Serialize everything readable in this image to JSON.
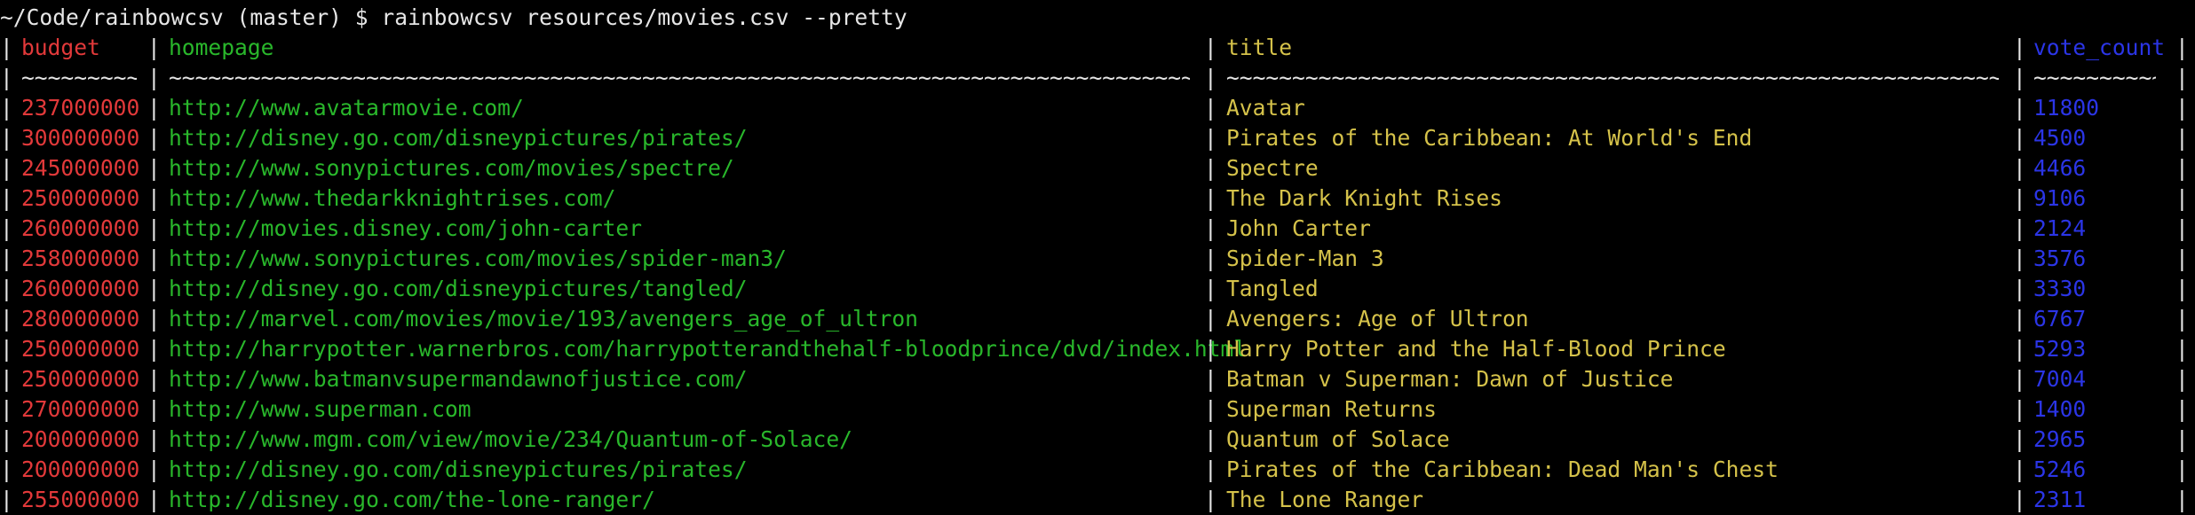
{
  "terminal": {
    "prompt": "~/Code/rainbowcsv (master) $ rainbowcsv resources/movies.csv --pretty",
    "separator": "|",
    "colors": {
      "budget": "#e2393a",
      "homepage": "#29b72b",
      "title": "#d5c24a",
      "vote_count": "#2b35e6",
      "text": "#e6e6e6",
      "background": "#000000"
    }
  },
  "table": {
    "headers": [
      "budget",
      "homepage",
      "title",
      "vote_count"
    ],
    "underlines": {
      "budget": "~~~~~~~~~",
      "homepage": "~~~~~~~~~~~~~~~~~~~~~~~~~~~~~~~~~~~~~~~~~~~~~~~~~~~~~~~~~~~~~~~~~~~~~~~~~~~~~~~~~~~~~~",
      "title": "~~~~~~~~~~~~~~~~~~~~~~~~~~~~~~~~~~~~~~~~~~~~~~~~~~~~~~~~~~~~~~~~~~~~~~~~~~~~~~~~~~~~",
      "vote_count": "~~~~~~~~~~"
    },
    "rows": [
      {
        "budget": "237000000",
        "homepage": "http://www.avatarmovie.com/",
        "title": "Avatar",
        "vote_count": "11800"
      },
      {
        "budget": "300000000",
        "homepage": "http://disney.go.com/disneypictures/pirates/",
        "title": "Pirates of the Caribbean: At World's End",
        "vote_count": "4500"
      },
      {
        "budget": "245000000",
        "homepage": "http://www.sonypictures.com/movies/spectre/",
        "title": "Spectre",
        "vote_count": "4466"
      },
      {
        "budget": "250000000",
        "homepage": "http://www.thedarkknightrises.com/",
        "title": "The Dark Knight Rises",
        "vote_count": "9106"
      },
      {
        "budget": "260000000",
        "homepage": "http://movies.disney.com/john-carter",
        "title": "John Carter",
        "vote_count": "2124"
      },
      {
        "budget": "258000000",
        "homepage": "http://www.sonypictures.com/movies/spider-man3/",
        "title": "Spider-Man 3",
        "vote_count": "3576"
      },
      {
        "budget": "260000000",
        "homepage": "http://disney.go.com/disneypictures/tangled/",
        "title": "Tangled",
        "vote_count": "3330"
      },
      {
        "budget": "280000000",
        "homepage": "http://marvel.com/movies/movie/193/avengers_age_of_ultron",
        "title": "Avengers: Age of Ultron",
        "vote_count": "6767"
      },
      {
        "budget": "250000000",
        "homepage": "http://harrypotter.warnerbros.com/harrypotterandthehalf-bloodprince/dvd/index.html",
        "title": "Harry Potter and the Half-Blood Prince",
        "vote_count": "5293"
      },
      {
        "budget": "250000000",
        "homepage": "http://www.batmanvsupermandawnofjustice.com/",
        "title": "Batman v Superman: Dawn of Justice",
        "vote_count": "7004"
      },
      {
        "budget": "270000000",
        "homepage": "http://www.superman.com",
        "title": "Superman Returns",
        "vote_count": "1400"
      },
      {
        "budget": "200000000",
        "homepage": "http://www.mgm.com/view/movie/234/Quantum-of-Solace/",
        "title": "Quantum of Solace",
        "vote_count": "2965"
      },
      {
        "budget": "200000000",
        "homepage": "http://disney.go.com/disneypictures/pirates/",
        "title": "Pirates of the Caribbean: Dead Man's Chest",
        "vote_count": "5246"
      },
      {
        "budget": "255000000",
        "homepage": "http://disney.go.com/the-lone-ranger/",
        "title": "The Lone Ranger",
        "vote_count": "2311"
      }
    ]
  }
}
